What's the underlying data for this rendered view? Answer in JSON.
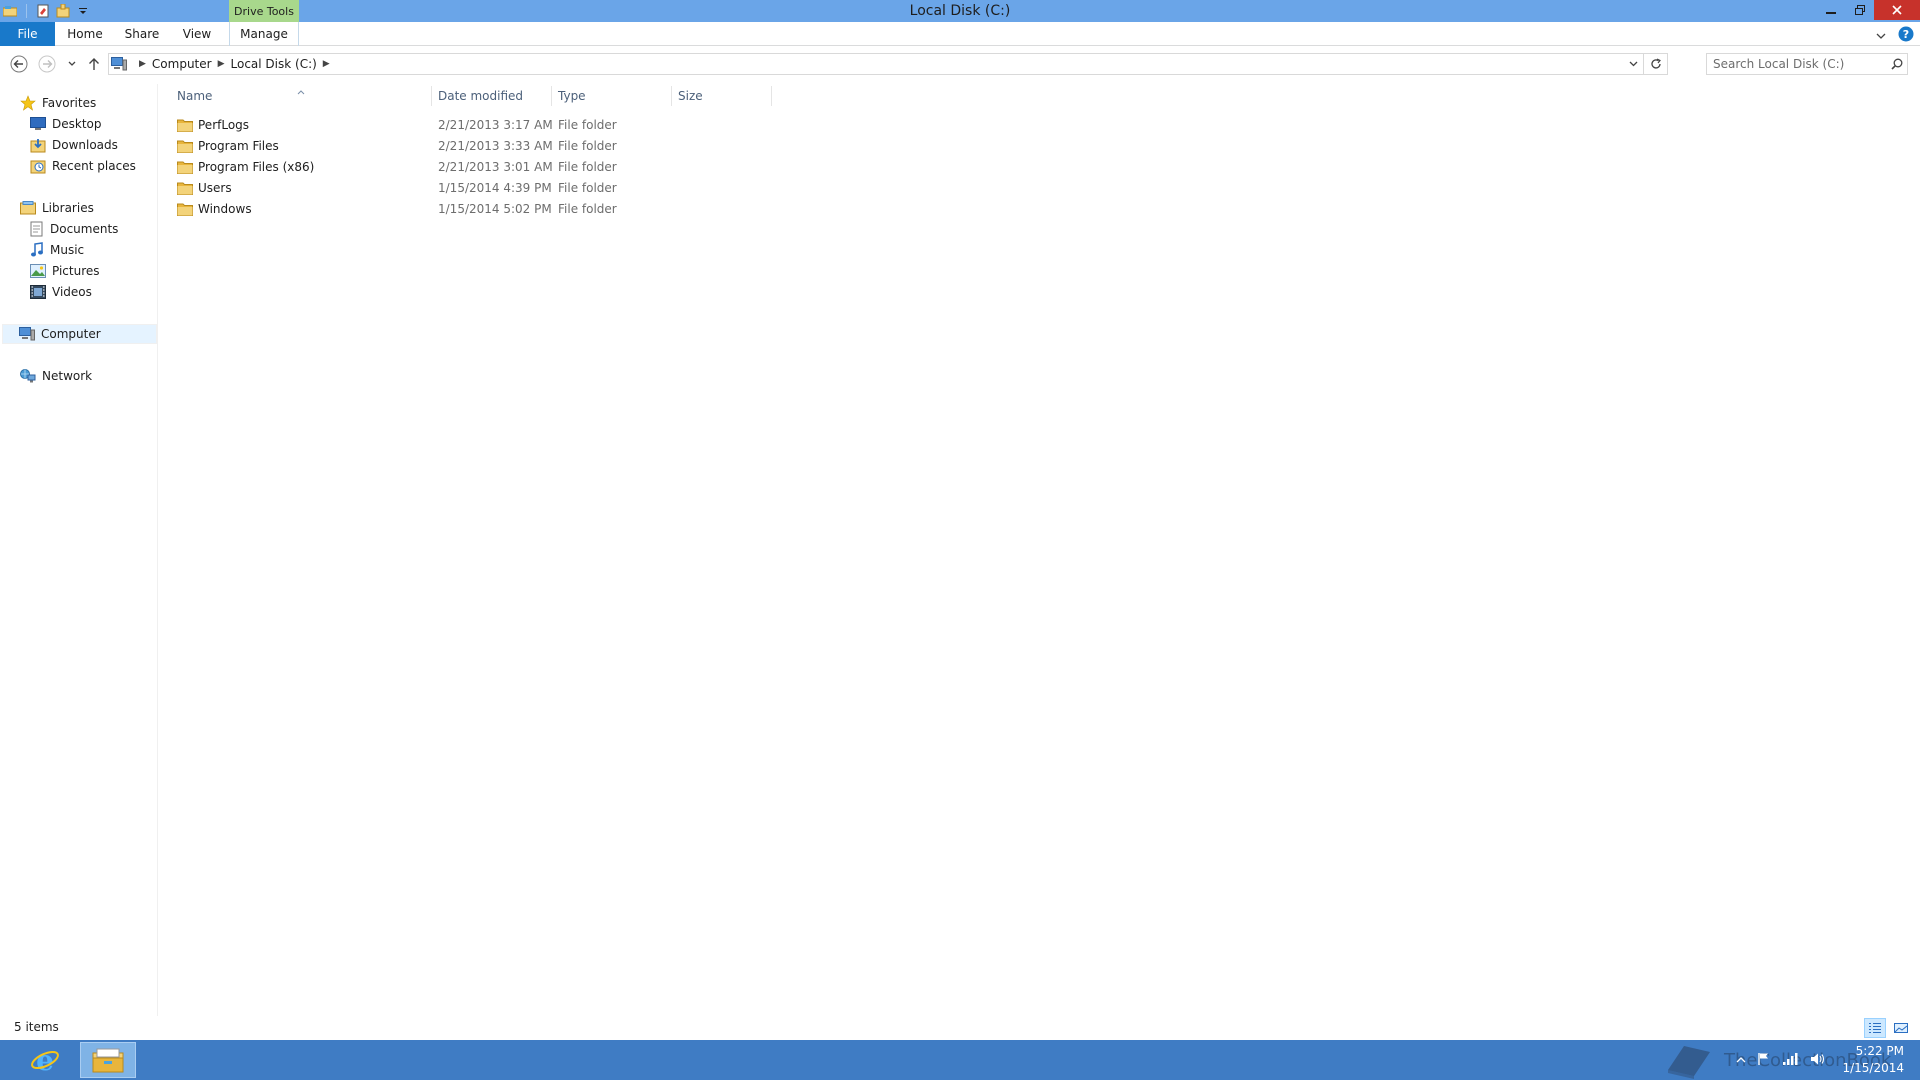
{
  "window": {
    "title": "Local Disk (C:)",
    "context_tab": "Drive Tools"
  },
  "ribbon": {
    "tabs": [
      "File",
      "Home",
      "Share",
      "View",
      "Manage"
    ]
  },
  "address": {
    "crumbs": [
      "Computer",
      "Local Disk (C:)"
    ]
  },
  "search": {
    "placeholder": "Search Local Disk (C:)"
  },
  "nav": {
    "favorites": "Favorites",
    "desktop": "Desktop",
    "downloads": "Downloads",
    "recent": "Recent places",
    "libraries": "Libraries",
    "documents": "Documents",
    "music": "Music",
    "pictures": "Pictures",
    "videos": "Videos",
    "computer": "Computer",
    "network": "Network"
  },
  "columns": {
    "name": "Name",
    "date": "Date modified",
    "type": "Type",
    "size": "Size"
  },
  "files": [
    {
      "name": "PerfLogs",
      "date": "2/21/2013 3:17 AM",
      "type": "File folder"
    },
    {
      "name": "Program Files",
      "date": "2/21/2013 3:33 AM",
      "type": "File folder"
    },
    {
      "name": "Program Files (x86)",
      "date": "2/21/2013 3:01 AM",
      "type": "File folder"
    },
    {
      "name": "Users",
      "date": "1/15/2014 4:39 PM",
      "type": "File folder"
    },
    {
      "name": "Windows",
      "date": "1/15/2014 5:02 PM",
      "type": "File folder"
    }
  ],
  "status": {
    "items": "5 items"
  },
  "taskbar": {
    "watermark": "TheCollectionBook",
    "time": "5:22 PM",
    "date": "1/15/2014"
  },
  "colors": {
    "titlebar": "#6aa5e8",
    "file_tab": "#1979ca",
    "drive_tools": "#a8d88c",
    "close": "#c7322b",
    "taskbar": "#3f7cc4",
    "folder": "#e8b53c"
  },
  "icons": [
    "explorer-icon",
    "properties-icon",
    "new-folder-icon",
    "star-icon",
    "desktop-icon",
    "downloads-icon",
    "recent-places-icon",
    "libraries-icon",
    "documents-icon",
    "music-icon",
    "pictures-icon",
    "videos-icon",
    "computer-icon",
    "network-icon",
    "folder-icon",
    "internet-explorer-icon",
    "file-explorer-icon",
    "search-icon",
    "refresh-icon",
    "help-icon"
  ]
}
